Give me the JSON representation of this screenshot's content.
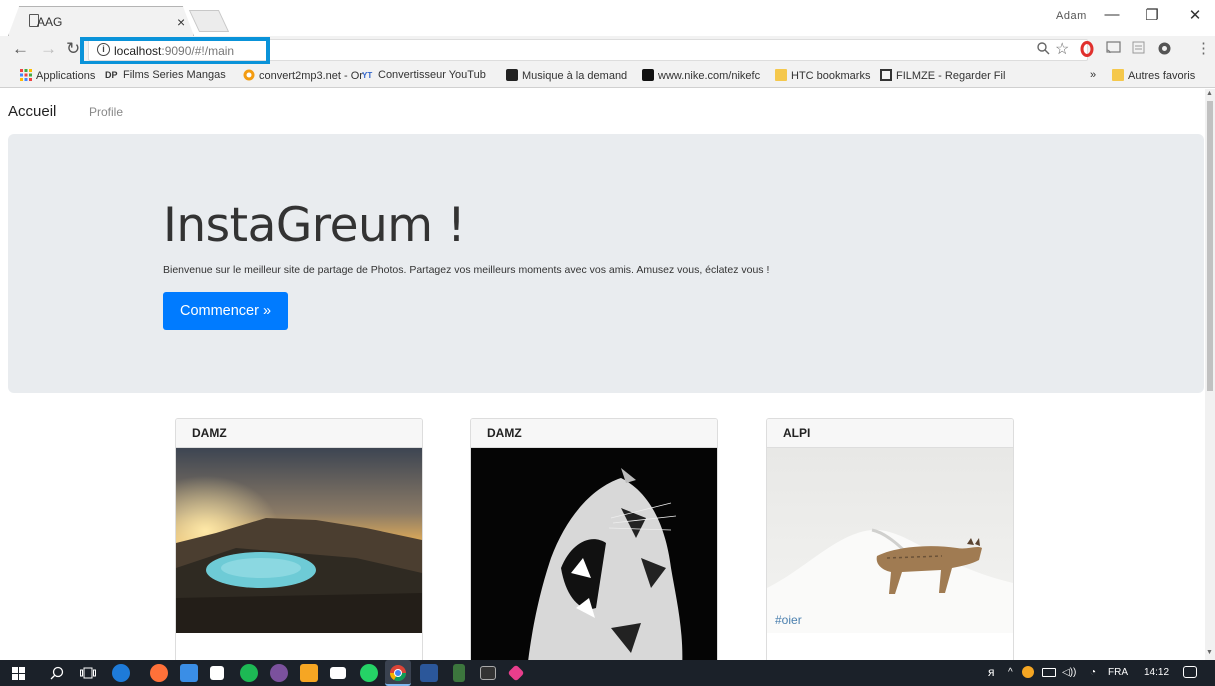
{
  "browser": {
    "tab_title": "AAG",
    "tab_close": "×",
    "user_name": "Adam",
    "win_minimize": "—",
    "win_restore": "❐",
    "win_close": "✕",
    "url_host": "localhost",
    "url_rest": ":9090/#!/main",
    "info_glyph": "i"
  },
  "bookmarks": {
    "items": [
      {
        "label": "Applications",
        "icon": "apps-grid-icon"
      },
      {
        "label": "Films Series Mangas",
        "icon": "dp-icon"
      },
      {
        "label": "convert2mp3.net - Or",
        "icon": "convert-icon"
      },
      {
        "label": "Convertisseur YouTub",
        "icon": "yt-mp3-icon"
      },
      {
        "label": "Musique à la demand",
        "icon": "music-icon"
      },
      {
        "label": "www.nike.com/nikefc",
        "icon": "nike-icon"
      },
      {
        "label": "HTC bookmarks",
        "icon": "folder-icon"
      },
      {
        "label": "FILMZE - Regarder Fil",
        "icon": "film-icon"
      }
    ],
    "overflow": "»",
    "other": "Autres favoris"
  },
  "navbar": {
    "brand": "Accueil",
    "link": "Profile"
  },
  "jumbotron": {
    "title": "InstaGreum !",
    "lead": "Bienvenue sur le meilleur site de partage de Photos. Partagez vos meilleurs moments avec vos amis. Amusez vous, éclatez vous !",
    "button": "Commencer »"
  },
  "cards": [
    {
      "author": "DAMZ",
      "image": "volcano-lake-photo",
      "tag": ""
    },
    {
      "author": "DAMZ",
      "image": "tiger-roar-photo",
      "tag": ""
    },
    {
      "author": "ALPI",
      "image": "lynx-snow-photo",
      "tag": "#oier"
    }
  ],
  "taskbar": {
    "language": "FRA",
    "time": "14:12"
  },
  "colors": {
    "accent": "#007bff",
    "url_highlight": "#0a93d9",
    "jumbotron_bg": "#e9ecef",
    "taskbar_bg": "#1b2129"
  }
}
